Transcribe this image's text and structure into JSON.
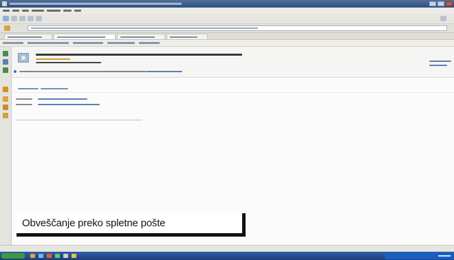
{
  "window": {
    "title": ""
  },
  "browser": {
    "menu_items": [
      "",
      "",
      "",
      "",
      "",
      "",
      ""
    ],
    "url": "",
    "tabs": [
      "",
      "",
      "",
      ""
    ]
  },
  "message": {
    "subject": "",
    "sender": "",
    "date": "",
    "info_text": "",
    "info_link": "",
    "actions": [
      "",
      ""
    ],
    "fields": [
      {
        "label": "",
        "value": ""
      },
      {
        "label": "",
        "value": ""
      }
    ],
    "reply_links": [
      "",
      ""
    ]
  },
  "caption": {
    "text": "Obveščanje preko spletne pošte"
  },
  "colors": {
    "titlebar": "#2f4f7f",
    "link": "#5b7fb8",
    "sender": "#d29a2e",
    "taskbar": "#1d3f7a",
    "start_button": "#3e9a3e"
  }
}
